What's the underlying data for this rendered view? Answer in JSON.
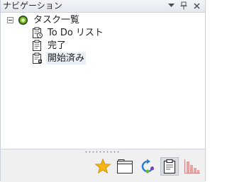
{
  "panel": {
    "title": "ナビゲーション"
  },
  "tree": {
    "root": {
      "label": "タスク一覧",
      "icon": "green-circle-icon",
      "expanded": true
    },
    "items": [
      {
        "label": "To Do リスト",
        "icon": "clipboard-clock-icon"
      },
      {
        "label": "完了",
        "icon": "clipboard-icon"
      },
      {
        "label": "開始済み",
        "icon": "clipboard-start-icon",
        "selected": true
      }
    ]
  },
  "bottom_bar": {
    "icons": [
      "star-icon",
      "folder-icon",
      "sync-icon",
      "clipboard-icon",
      "chart-icon"
    ],
    "active": "clipboard-icon"
  },
  "colors": {
    "accent_green": "#6fb823",
    "selection": "#e9eef5",
    "star": "#f5b316",
    "chart": "#e8a2a2"
  }
}
